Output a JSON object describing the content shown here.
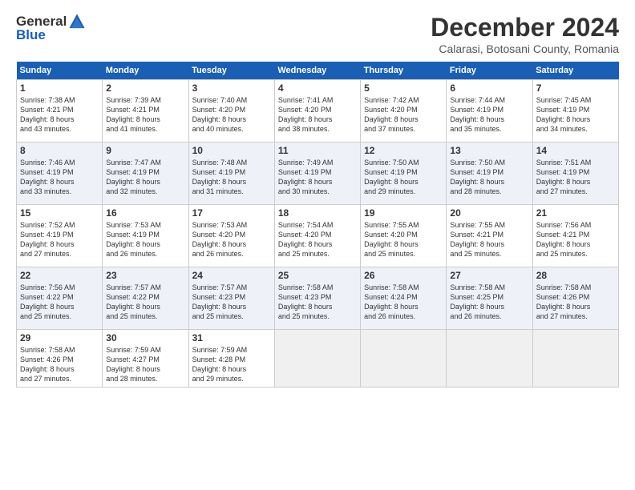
{
  "logo": {
    "general": "General",
    "blue": "Blue"
  },
  "title": "December 2024",
  "subtitle": "Calarasi, Botosani County, Romania",
  "headers": [
    "Sunday",
    "Monday",
    "Tuesday",
    "Wednesday",
    "Thursday",
    "Friday",
    "Saturday"
  ],
  "weeks": [
    [
      {
        "day": "1",
        "info": "Sunrise: 7:38 AM\nSunset: 4:21 PM\nDaylight: 8 hours\nand 43 minutes."
      },
      {
        "day": "2",
        "info": "Sunrise: 7:39 AM\nSunset: 4:21 PM\nDaylight: 8 hours\nand 41 minutes."
      },
      {
        "day": "3",
        "info": "Sunrise: 7:40 AM\nSunset: 4:20 PM\nDaylight: 8 hours\nand 40 minutes."
      },
      {
        "day": "4",
        "info": "Sunrise: 7:41 AM\nSunset: 4:20 PM\nDaylight: 8 hours\nand 38 minutes."
      },
      {
        "day": "5",
        "info": "Sunrise: 7:42 AM\nSunset: 4:20 PM\nDaylight: 8 hours\nand 37 minutes."
      },
      {
        "day": "6",
        "info": "Sunrise: 7:44 AM\nSunset: 4:19 PM\nDaylight: 8 hours\nand 35 minutes."
      },
      {
        "day": "7",
        "info": "Sunrise: 7:45 AM\nSunset: 4:19 PM\nDaylight: 8 hours\nand 34 minutes."
      }
    ],
    [
      {
        "day": "8",
        "info": "Sunrise: 7:46 AM\nSunset: 4:19 PM\nDaylight: 8 hours\nand 33 minutes."
      },
      {
        "day": "9",
        "info": "Sunrise: 7:47 AM\nSunset: 4:19 PM\nDaylight: 8 hours\nand 32 minutes."
      },
      {
        "day": "10",
        "info": "Sunrise: 7:48 AM\nSunset: 4:19 PM\nDaylight: 8 hours\nand 31 minutes."
      },
      {
        "day": "11",
        "info": "Sunrise: 7:49 AM\nSunset: 4:19 PM\nDaylight: 8 hours\nand 30 minutes."
      },
      {
        "day": "12",
        "info": "Sunrise: 7:50 AM\nSunset: 4:19 PM\nDaylight: 8 hours\nand 29 minutes."
      },
      {
        "day": "13",
        "info": "Sunrise: 7:50 AM\nSunset: 4:19 PM\nDaylight: 8 hours\nand 28 minutes."
      },
      {
        "day": "14",
        "info": "Sunrise: 7:51 AM\nSunset: 4:19 PM\nDaylight: 8 hours\nand 27 minutes."
      }
    ],
    [
      {
        "day": "15",
        "info": "Sunrise: 7:52 AM\nSunset: 4:19 PM\nDaylight: 8 hours\nand 27 minutes."
      },
      {
        "day": "16",
        "info": "Sunrise: 7:53 AM\nSunset: 4:19 PM\nDaylight: 8 hours\nand 26 minutes."
      },
      {
        "day": "17",
        "info": "Sunrise: 7:53 AM\nSunset: 4:20 PM\nDaylight: 8 hours\nand 26 minutes."
      },
      {
        "day": "18",
        "info": "Sunrise: 7:54 AM\nSunset: 4:20 PM\nDaylight: 8 hours\nand 25 minutes."
      },
      {
        "day": "19",
        "info": "Sunrise: 7:55 AM\nSunset: 4:20 PM\nDaylight: 8 hours\nand 25 minutes."
      },
      {
        "day": "20",
        "info": "Sunrise: 7:55 AM\nSunset: 4:21 PM\nDaylight: 8 hours\nand 25 minutes."
      },
      {
        "day": "21",
        "info": "Sunrise: 7:56 AM\nSunset: 4:21 PM\nDaylight: 8 hours\nand 25 minutes."
      }
    ],
    [
      {
        "day": "22",
        "info": "Sunrise: 7:56 AM\nSunset: 4:22 PM\nDaylight: 8 hours\nand 25 minutes."
      },
      {
        "day": "23",
        "info": "Sunrise: 7:57 AM\nSunset: 4:22 PM\nDaylight: 8 hours\nand 25 minutes."
      },
      {
        "day": "24",
        "info": "Sunrise: 7:57 AM\nSunset: 4:23 PM\nDaylight: 8 hours\nand 25 minutes."
      },
      {
        "day": "25",
        "info": "Sunrise: 7:58 AM\nSunset: 4:23 PM\nDaylight: 8 hours\nand 25 minutes."
      },
      {
        "day": "26",
        "info": "Sunrise: 7:58 AM\nSunset: 4:24 PM\nDaylight: 8 hours\nand 26 minutes."
      },
      {
        "day": "27",
        "info": "Sunrise: 7:58 AM\nSunset: 4:25 PM\nDaylight: 8 hours\nand 26 minutes."
      },
      {
        "day": "28",
        "info": "Sunrise: 7:58 AM\nSunset: 4:26 PM\nDaylight: 8 hours\nand 27 minutes."
      }
    ],
    [
      {
        "day": "29",
        "info": "Sunrise: 7:58 AM\nSunset: 4:26 PM\nDaylight: 8 hours\nand 27 minutes."
      },
      {
        "day": "30",
        "info": "Sunrise: 7:59 AM\nSunset: 4:27 PM\nDaylight: 8 hours\nand 28 minutes."
      },
      {
        "day": "31",
        "info": "Sunrise: 7:59 AM\nSunset: 4:28 PM\nDaylight: 8 hours\nand 29 minutes."
      },
      null,
      null,
      null,
      null
    ]
  ]
}
